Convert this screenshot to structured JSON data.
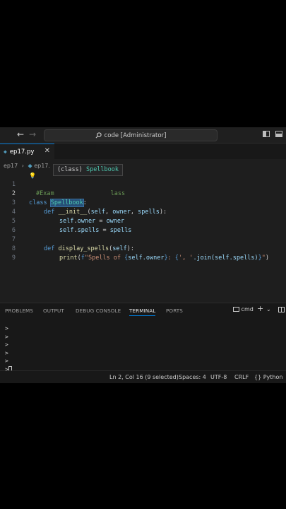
{
  "titlebar": {
    "back": "←",
    "forward": "→",
    "search_text": "code [Administrator]"
  },
  "tab": {
    "filename": "ep17.py",
    "icon": "python-file-icon",
    "close": "✕"
  },
  "breadcrumb": {
    "folder": "ep17",
    "file": "ep17."
  },
  "tooltip": {
    "prefix": "(class) ",
    "name": "Spellbook"
  },
  "editor": {
    "lines": [
      "1",
      "2",
      "3",
      "4",
      "5",
      "6",
      "7",
      "8",
      "9"
    ],
    "line1_a": "#Exam",
    "line1_b": "lass",
    "line2_kw": "class ",
    "line2_name": "Spellbook",
    "line2_colon": ":",
    "line3_def": "def ",
    "line3_fn": "__init__",
    "line3_open": "(",
    "line3_self": "self",
    "line3_c1": ", ",
    "line3_owner": "owner",
    "line3_c2": ", ",
    "line3_spells": "spells",
    "line3_close": "):",
    "line4_self": "self",
    "line4_dot": ".",
    "line4_owner": "owner",
    "line4_eq": " = ",
    "line4_val": "owner",
    "line5_self": "self",
    "line5_dot": ".",
    "line5_spells": "spells",
    "line5_eq": " = ",
    "line5_val": "spells",
    "line7_def": "def ",
    "line7_fn": "display_spells",
    "line7_open": "(",
    "line7_self": "self",
    "line7_close": "):",
    "line8_fn": "print",
    "line8_open": "(",
    "line8_f": "f",
    "line8_s1": "\"Spells of ",
    "line8_b1": "{",
    "line8_e1": "self.owner",
    "line8_b2": "}",
    "line8_s2": ": ",
    "line8_b3": "{",
    "line8_s3": "', '",
    "line8_e2": ".join(self.spells)",
    "line8_b4": "}",
    "line8_s4": "\"",
    "line8_close": ")"
  },
  "panel": {
    "tabs": [
      "PROBLEMS",
      "OUTPUT",
      "DEBUG CONSOLE",
      "TERMINAL",
      "PORTS"
    ],
    "terminal_name": "cmd",
    "add": "+",
    "dropdown": "⌄",
    "lines": [
      ">",
      ">",
      ">",
      ">",
      ">",
      ">"
    ]
  },
  "status": {
    "position": "Ln 2, Col 16 (9 selected)",
    "spaces": "Spaces: 4",
    "encoding": "UTF-8",
    "eol": "CRLF",
    "language": "Python"
  },
  "colors": {
    "accent": "#0078d4",
    "selection": "#264f78",
    "keyword": "#569cd6",
    "class": "#4ec9b0"
  }
}
